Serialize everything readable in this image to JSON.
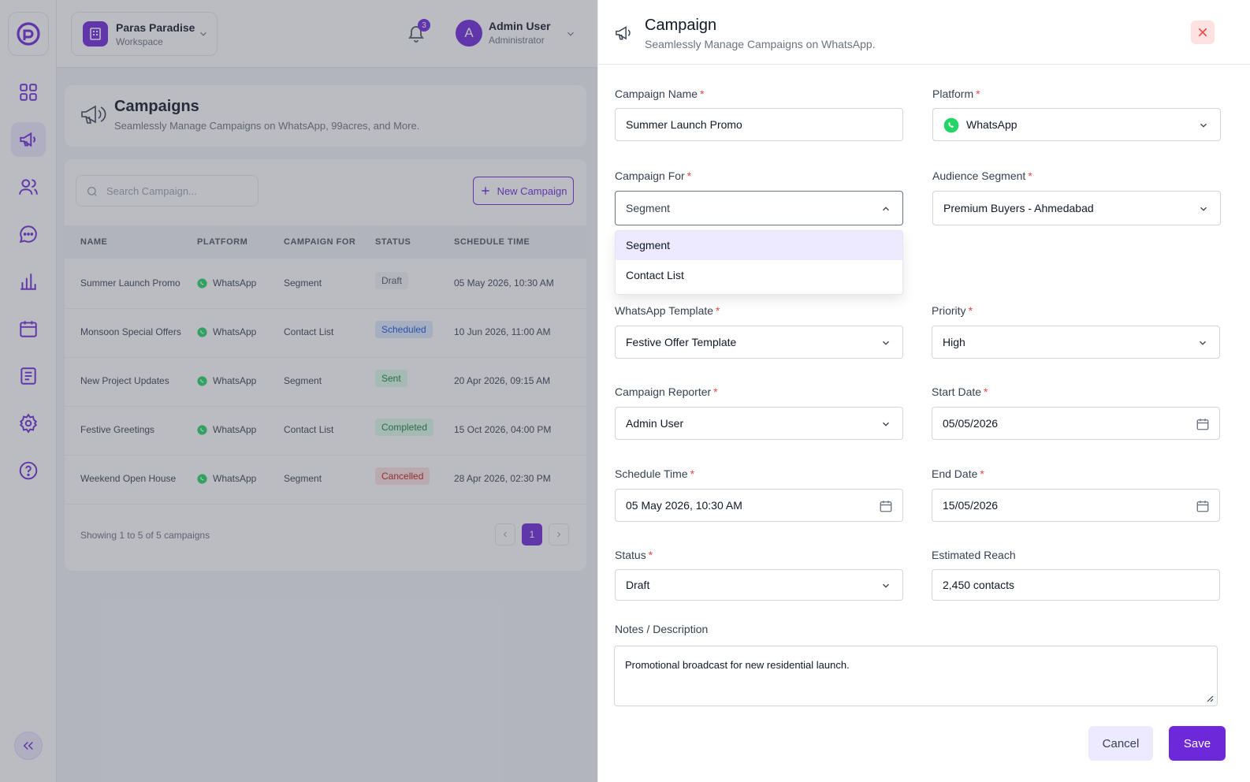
{
  "workspace": {
    "name": "Paras Paradise",
    "sub": "Workspace"
  },
  "notifications": {
    "count": "3"
  },
  "user": {
    "initial": "A",
    "name": "Admin User",
    "role": "Administrator"
  },
  "page": {
    "title": "Campaigns",
    "subtitle": "Seamlessly Manage Campaigns on WhatsApp, 99acres, and More."
  },
  "search": {
    "placeholder": "Search Campaign..."
  },
  "new_campaign_label": "New Campaign",
  "table": {
    "headers": [
      "NAME",
      "PLATFORM",
      "CAMPAIGN FOR",
      "STATUS",
      "SCHEDULE TIME"
    ],
    "rows": [
      {
        "name": "Summer Launch Promo",
        "platform": "WhatsApp",
        "for": "Segment",
        "status": "Draft",
        "time": "05 May 2026, 10:30 AM"
      },
      {
        "name": "Monsoon Special Offers",
        "platform": "WhatsApp",
        "for": "Contact List",
        "status": "Scheduled",
        "time": "10 Jun 2026, 11:00 AM"
      },
      {
        "name": "New Project Updates",
        "platform": "WhatsApp",
        "for": "Segment",
        "status": "Sent",
        "time": "20 Apr 2026, 09:15 AM"
      },
      {
        "name": "Festive Greetings",
        "platform": "WhatsApp",
        "for": "Contact List",
        "status": "Completed",
        "time": "15 Oct 2026, 04:00 PM"
      },
      {
        "name": "Weekend Open House",
        "platform": "WhatsApp",
        "for": "Segment",
        "status": "Cancelled",
        "time": "28 Apr 2026, 02:30 PM"
      }
    ],
    "footer": "Showing 1 to 5 of 5 campaigns",
    "page": "1"
  },
  "drawer": {
    "title": "Campaign",
    "subtitle": "Seamlessly Manage Campaigns on WhatsApp.",
    "fields": {
      "campaign_name": {
        "label": "Campaign Name",
        "value": "Summer Launch Promo"
      },
      "platform": {
        "label": "Platform",
        "value": "WhatsApp"
      },
      "campaign_for": {
        "label": "Campaign For",
        "value": "Segment",
        "options": [
          "Segment",
          "Contact List"
        ]
      },
      "audience_segment": {
        "label": "Audience Segment",
        "value": "Premium Buyers - Ahmedabad"
      },
      "whatsapp_template": {
        "label": "WhatsApp Template",
        "value": "Festive Offer Template"
      },
      "priority": {
        "label": "Priority",
        "value": "High"
      },
      "campaign_reporter": {
        "label": "Campaign Reporter",
        "value": "Admin User"
      },
      "start_date": {
        "label": "Start Date",
        "value": "05/05/2026"
      },
      "schedule_time": {
        "label": "Schedule Time",
        "value": "05 May 2026, 10:30 AM"
      },
      "end_date": {
        "label": "End Date",
        "value": "15/05/2026"
      },
      "status": {
        "label": "Status",
        "value": "Draft"
      },
      "estimated_reach": {
        "label": "Estimated Reach",
        "value": "2,450 contacts"
      },
      "notes": {
        "label": "Notes / Description",
        "value": "Promotional broadcast for new residential launch."
      }
    },
    "required_mark": "*",
    "cancel_label": "Cancel",
    "save_label": "Save"
  },
  "colors": {
    "accent": "#6d28d9",
    "accent_soft": "#ede9fe",
    "whatsapp": "#25d366",
    "danger": "#ef4444"
  }
}
